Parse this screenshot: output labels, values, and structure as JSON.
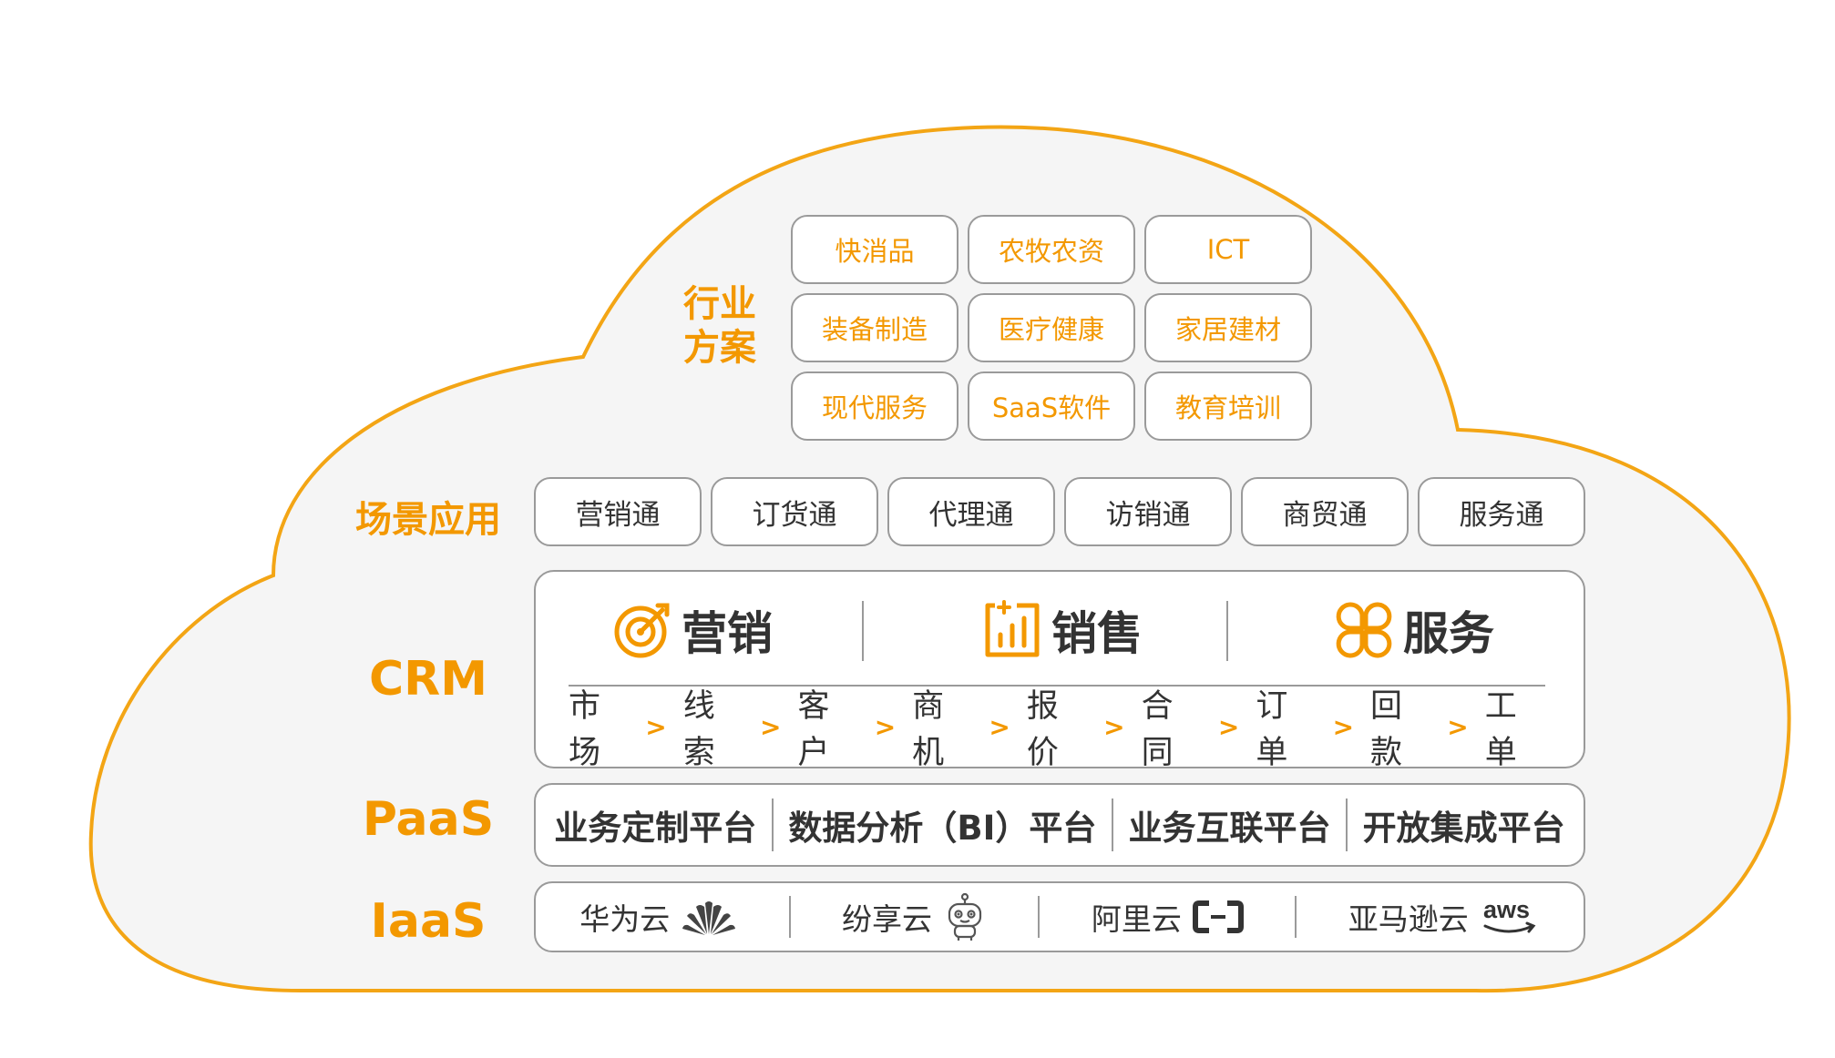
{
  "colors": {
    "accent": "#F39800",
    "text": "#333333",
    "border": "#9a9a9a",
    "cloud_fill": "#f5f5f5"
  },
  "labels": {
    "industry_line1": "行业",
    "industry_line2": "方案",
    "scenario": "场景应用",
    "crm": "CRM",
    "paas": "PaaS",
    "iaas": "IaaS"
  },
  "industries": [
    "快消品",
    "农牧农资",
    "ICT",
    "装备制造",
    "医疗健康",
    "家居建材",
    "现代服务",
    "SaaS软件",
    "教育培训"
  ],
  "scenarios": [
    "营销通",
    "订货通",
    "代理通",
    "访销通",
    "商贸通",
    "服务通"
  ],
  "crm": {
    "modules": [
      {
        "label": "营销",
        "icon": "target-icon"
      },
      {
        "label": "销售",
        "icon": "bar-chart-icon"
      },
      {
        "label": "服务",
        "icon": "clover-icon"
      }
    ],
    "flow": [
      "市场",
      "线索",
      "客户",
      "商机",
      "报价",
      "合同",
      "订单",
      "回款",
      "工单"
    ],
    "arrow": ">"
  },
  "paas": [
    "业务定制平台",
    "数据分析（BI）平台",
    "业务互联平台",
    "开放集成平台"
  ],
  "iaas": [
    {
      "label": "华为云",
      "icon": "huawei-logo-icon"
    },
    {
      "label": "纷享云",
      "icon": "robot-mascot-icon"
    },
    {
      "label": "阿里云",
      "icon": "aliyun-logo-icon"
    },
    {
      "label": "亚马逊云",
      "icon": "aws-logo-icon",
      "logo_text": "aws"
    }
  ]
}
